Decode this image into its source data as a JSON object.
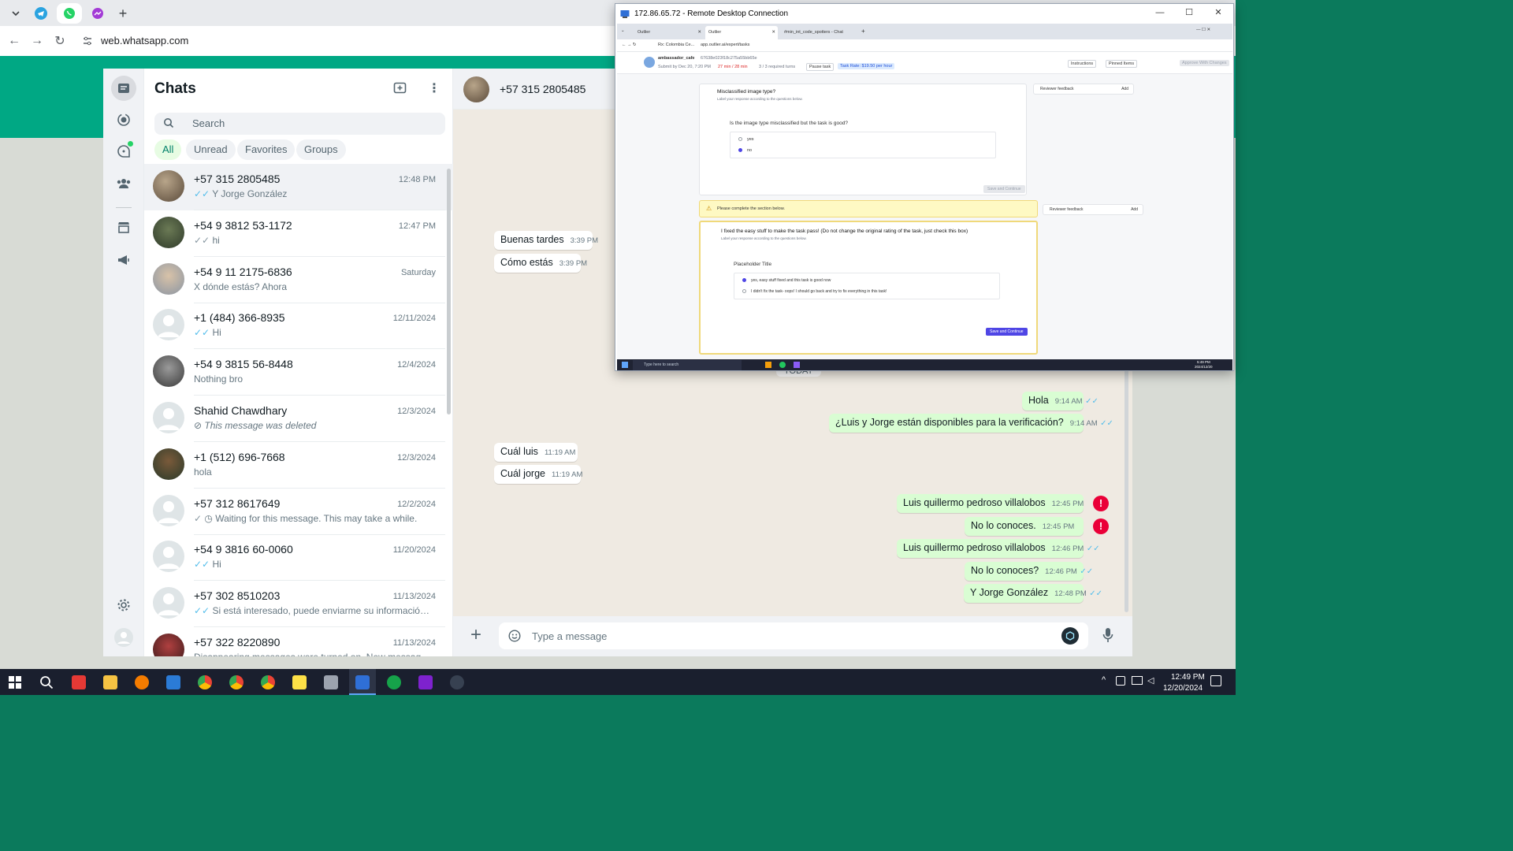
{
  "browser": {
    "url": "web.whatsapp.com"
  },
  "sidebar_title": "Chats",
  "search": {
    "placeholder": "Search"
  },
  "filters": [
    {
      "label": "All",
      "active": true
    },
    {
      "label": "Unread"
    },
    {
      "label": "Favorites"
    },
    {
      "label": "Groups"
    }
  ],
  "chats": [
    {
      "name": "+57 315 2805485",
      "time": "12:48 PM",
      "preview": "Y Jorge González",
      "status": "read"
    },
    {
      "name": "+54 9 3812 53-1172",
      "time": "12:47 PM",
      "preview": "hi",
      "status": "delivered"
    },
    {
      "name": "+54 9 11 2175-6836",
      "time": "Saturday",
      "preview": "X dónde estás? Ahora",
      "status": "none"
    },
    {
      "name": "+1 (484) 366-8935",
      "time": "12/11/2024",
      "preview": "Hi",
      "status": "read"
    },
    {
      "name": "+54 9 3815 56-8448",
      "time": "12/4/2024",
      "preview": "Nothing bro",
      "status": "none"
    },
    {
      "name": "Shahid Chawdhary",
      "time": "12/3/2024",
      "preview": "This message was deleted",
      "status": "deleted"
    },
    {
      "name": "+1 (512) 696-7668",
      "time": "12/3/2024",
      "preview": "hola",
      "status": "none"
    },
    {
      "name": "+57 312 8617649",
      "time": "12/2/2024",
      "preview": "Waiting for this message. This may take a while.",
      "status": "waiting"
    },
    {
      "name": "+54 9 3816 60-0060",
      "time": "11/20/2024",
      "preview": "Hi",
      "status": "read"
    },
    {
      "name": "+57 302 8510203",
      "time": "11/13/2024",
      "preview": "Si está interesado, puede enviarme su información. Des...",
      "status": "read"
    },
    {
      "name": "+57 322 8220890",
      "time": "11/13/2024",
      "preview": "Disappearing messages were turned on. New messages will...",
      "status": "none"
    }
  ],
  "conversation": {
    "contact": "+57 315 2805485",
    "today_label": "TODAY",
    "messages": [
      {
        "dir": "in",
        "text": "Buenas tardes",
        "time": "3:39 PM"
      },
      {
        "dir": "in",
        "text": "Cómo estás",
        "time": "3:39 PM"
      },
      {
        "dir": "out",
        "text": "Hola",
        "time": "9:14 AM",
        "status": "read"
      },
      {
        "dir": "out",
        "text": "¿Luis y Jorge están disponibles para la verificación?",
        "time": "9:14 AM",
        "status": "read"
      },
      {
        "dir": "in",
        "text": "Cuál luis",
        "time": "11:19 AM"
      },
      {
        "dir": "in",
        "text": "Cuál jorge",
        "time": "11:19 AM"
      },
      {
        "dir": "out",
        "text": "Luis quillermo pedroso villalobos",
        "time": "12:45 PM",
        "status": "error"
      },
      {
        "dir": "out",
        "text": "No lo conoces.",
        "time": "12:45 PM",
        "status": "error"
      },
      {
        "dir": "out",
        "text": "Luis quillermo pedroso villalobos",
        "time": "12:46 PM",
        "status": "read"
      },
      {
        "dir": "out",
        "text": "No lo conoces?",
        "time": "12:46 PM",
        "status": "read"
      },
      {
        "dir": "out",
        "text": "Y Jorge González",
        "time": "12:48 PM",
        "status": "read"
      }
    ],
    "composer_placeholder": "Type a message"
  },
  "rdp": {
    "title": "172.86.65.72 - Remote Desktop Connection",
    "inner_tabs": [
      "Outlier",
      "Outlier",
      "#min_int_code_spotters - Chat"
    ],
    "inner_url": "app.outlier.ai/expert/tasks",
    "inner_bookmark": "Rx: Colombia Ce...",
    "task": {
      "user": "ambassador_cafe",
      "task_id": "67638e023f18c275a55bb65e",
      "submit_by": "Submit by Dec 20, 7:20 PM",
      "timer": "27 min / 28 min",
      "turns": "3 / 3 required turns",
      "pause": "Pause task",
      "rate": "Task Rate: $19.50 per hour",
      "instructions": "Instructions",
      "pinned": "Pinned Items",
      "approve": "Approve With Changes"
    },
    "section1": {
      "title": "Misclassified image type?",
      "subtitle": "Label your response according to the questions below.",
      "question": "Is the image type misclassified but the task is good?",
      "options": [
        "yes",
        "no"
      ],
      "selected": 1,
      "button": "Save and Continue"
    },
    "warning": "Please complete the section below.",
    "section2": {
      "title": "I fixed the easy stuff to make the task pass! (Do not change the original rating of the task, just check this box)",
      "subtitle": "Label your response according to the questions below.",
      "question": "Placeholder Title",
      "options": [
        "yes, easy stuff fixed and this task is good now",
        "I didn't fix the task- oops! I should go back and try to fix everything in this task!"
      ],
      "selected": 0,
      "button": "Save and Continue"
    },
    "reviewer_feedback": "Reviewer feedback",
    "add": "Add",
    "inner_search": "Type here to search",
    "inner_clock": "5:49 PM",
    "inner_date": "2024/12/20"
  },
  "taskbar": {
    "time": "12:49 PM",
    "date": "12/20/2024"
  },
  "colors": {
    "whatsapp_green": "#00a884",
    "outgoing_bubble": "#d9fdd3",
    "error": "#ea0038",
    "read_tick": "#53bdeb",
    "outlier_accent": "#4f46e5"
  }
}
